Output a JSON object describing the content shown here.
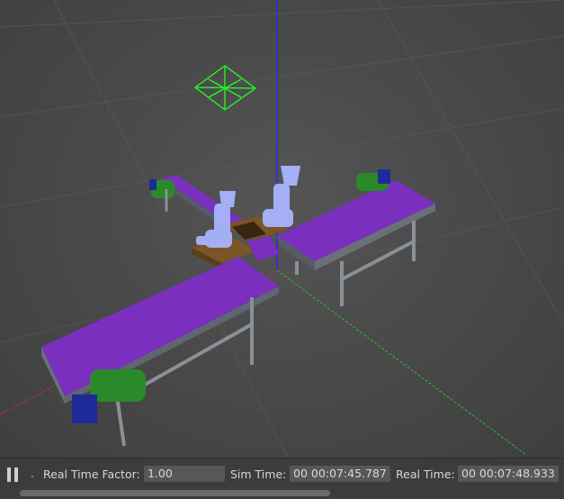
{
  "statusbar": {
    "rtf_label": "Real Time Factor:",
    "rtf_value": "1.00",
    "sim_label": "Sim Time:",
    "sim_value": "00 00:07:45.787",
    "real_label": "Real Time:",
    "real_value": "00 00:07:48.933"
  },
  "colors": {
    "belt": "#7b2fbf",
    "motor": "#2a8a2a",
    "z_axis": "#2828ff",
    "y_axis": "#2cc02c",
    "x_axis": "#c83030",
    "robot": "#a9b4ff",
    "table": "#7a5526"
  },
  "icons": [
    "pause-icon",
    "light-gizmo-icon"
  ]
}
